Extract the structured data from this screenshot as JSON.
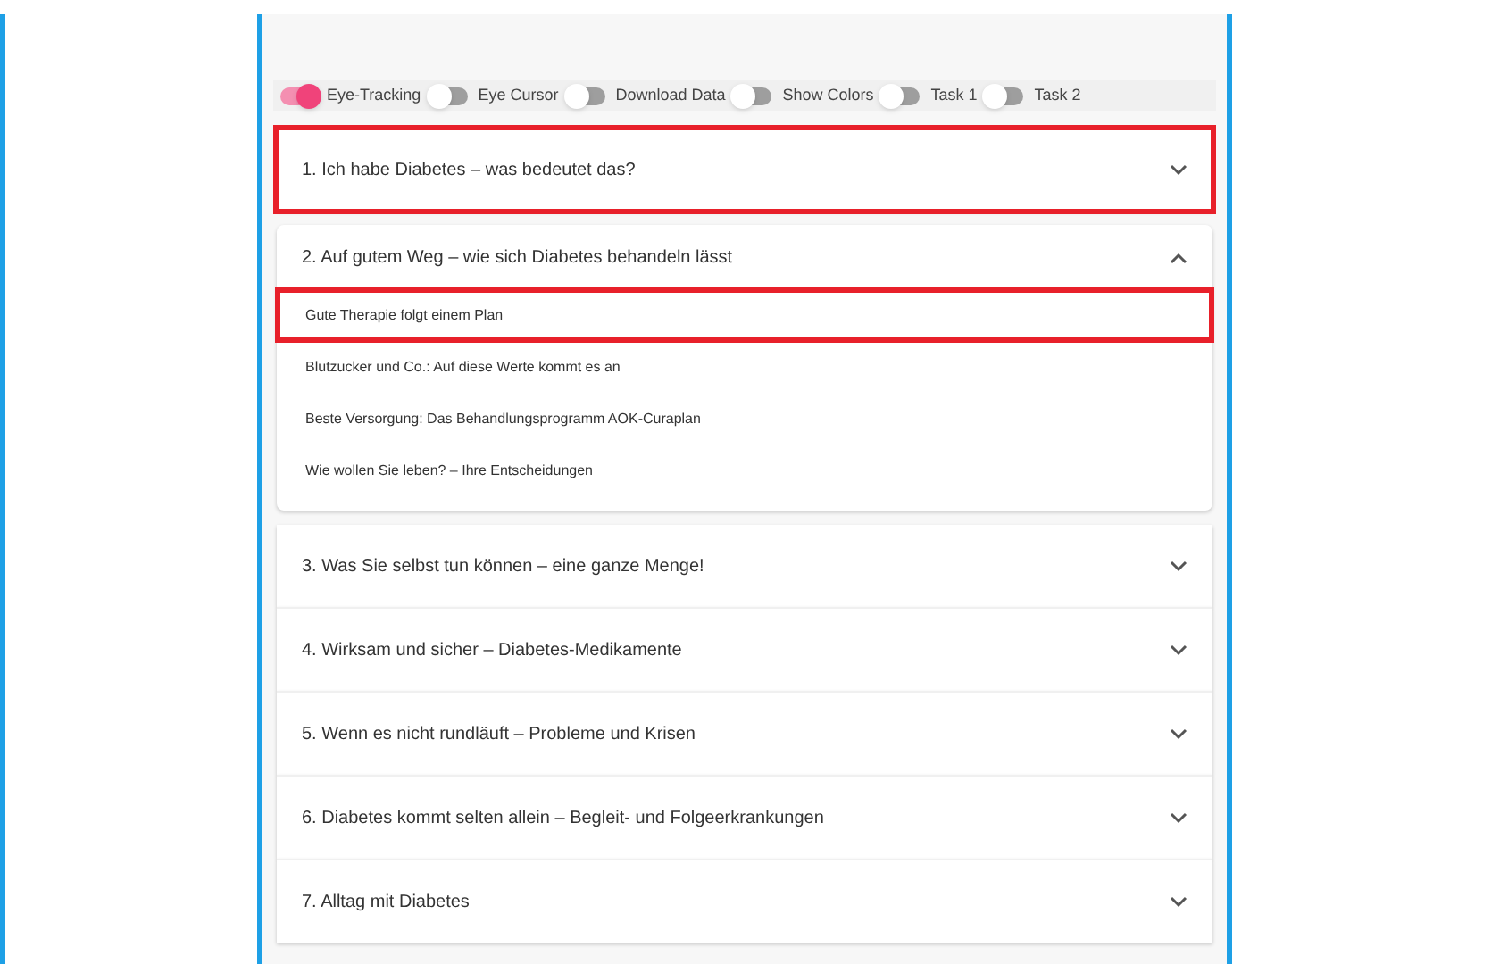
{
  "toggles": [
    {
      "label": "Eye-Tracking",
      "on": true
    },
    {
      "label": "Eye Cursor",
      "on": false
    },
    {
      "label": "Download Data",
      "on": false
    },
    {
      "label": "Show Colors",
      "on": false
    },
    {
      "label": "Task 1",
      "on": false
    },
    {
      "label": "Task 2",
      "on": false
    }
  ],
  "sections": [
    {
      "title": "1. Ich habe Diabetes – was bedeutet das?",
      "expanded": false,
      "highlighted": true
    },
    {
      "title": "2. Auf gutem Weg – wie sich Diabetes behandeln lässt",
      "expanded": true,
      "highlighted": false,
      "children": [
        {
          "label": "Gute Therapie folgt einem Plan",
          "highlighted": true
        },
        {
          "label": "Blutzucker und Co.: Auf diese Werte kommt es an",
          "highlighted": false
        },
        {
          "label": "Beste Versorgung: Das Behandlungsprogramm AOK-Curaplan",
          "highlighted": false
        },
        {
          "label": "Wie wollen Sie leben? – Ihre Entscheidungen",
          "highlighted": false
        }
      ]
    },
    {
      "title": "3. Was Sie selbst tun können – eine ganze Menge!",
      "expanded": false,
      "highlighted": false
    },
    {
      "title": "4. Wirksam und sicher – Diabetes-Medikamente",
      "expanded": false,
      "highlighted": false
    },
    {
      "title": "5. Wenn es nicht rundläuft – Probleme und Krisen",
      "expanded": false,
      "highlighted": false
    },
    {
      "title": "6. Diabetes kommt selten allein – Begleit- und Folgeerkrankungen",
      "expanded": false,
      "highlighted": false
    },
    {
      "title": "7. Alltag mit Diabetes",
      "expanded": false,
      "highlighted": false
    }
  ]
}
